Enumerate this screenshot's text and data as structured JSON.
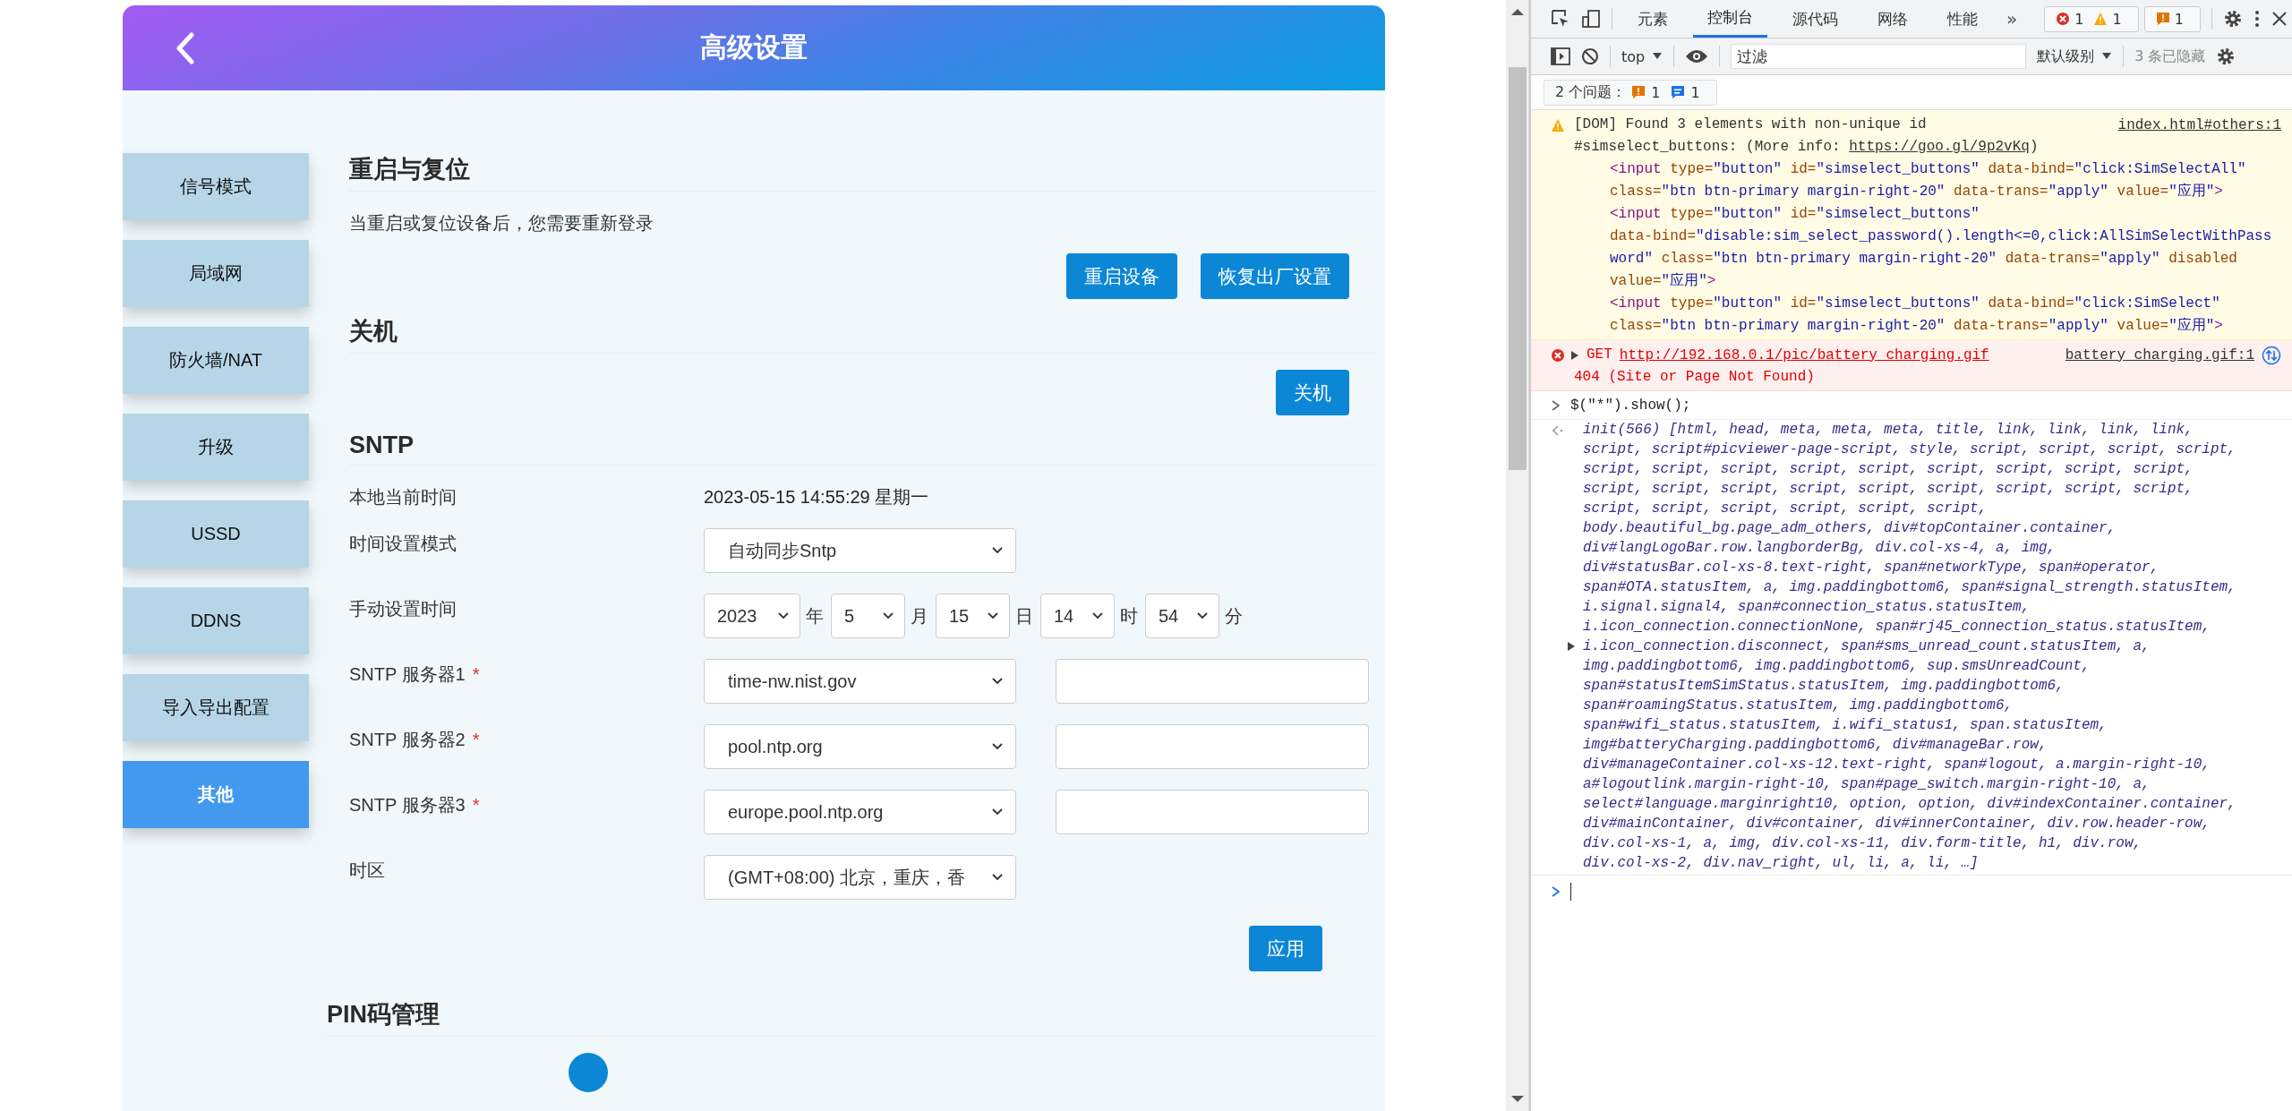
{
  "page": {
    "header": {
      "title": "高级设置"
    },
    "sidebar": {
      "items": [
        {
          "label": "信号模式",
          "selected": false
        },
        {
          "label": "局域网",
          "selected": false
        },
        {
          "label": "防火墙/NAT",
          "selected": false
        },
        {
          "label": "升级",
          "selected": false
        },
        {
          "label": "USSD",
          "selected": false
        },
        {
          "label": "DDNS",
          "selected": false
        },
        {
          "label": "导入导出配置",
          "selected": false
        },
        {
          "label": "其他",
          "selected": true
        }
      ]
    },
    "restart": {
      "title": "重启与复位",
      "note": "当重启或复位设备后，您需要重新登录",
      "buttons": [
        "重启设备",
        "恢复出厂设置"
      ]
    },
    "shutdown": {
      "title": "关机",
      "buttons": [
        "关机"
      ]
    },
    "sntp": {
      "title": "SNTP",
      "rows": [
        {
          "kind": "text",
          "label": "本地当前时间",
          "value": "2023-05-15 14:55:29 星期一"
        },
        {
          "kind": "select",
          "label": "时间设置模式",
          "value": "自动同步Sntp"
        },
        {
          "kind": "datetime",
          "label": "手动设置时间",
          "parts": [
            {
              "value": "2023",
              "unit": "年"
            },
            {
              "value": "5",
              "unit": "月"
            },
            {
              "value": "15",
              "unit": "日"
            },
            {
              "value": "14",
              "unit": "时"
            },
            {
              "value": "54",
              "unit": "分"
            }
          ]
        },
        {
          "kind": "server",
          "label": "SNTP 服务器1",
          "required": "*",
          "value": "time-nw.nist.gov"
        },
        {
          "kind": "server",
          "label": "SNTP 服务器2",
          "required": "*",
          "value": "pool.ntp.org"
        },
        {
          "kind": "server",
          "label": "SNTP 服务器3",
          "required": "*",
          "value": "europe.pool.ntp.org"
        },
        {
          "kind": "select",
          "label": "时区",
          "value": "(GMT+08:00) 北京，重庆，香"
        }
      ],
      "apply_button": "应用"
    },
    "pin": {
      "title": "PIN码管理"
    }
  },
  "devtools": {
    "tabs": [
      {
        "label": "元素",
        "selected": false
      },
      {
        "label": "控制台",
        "selected": true
      },
      {
        "label": "源代码",
        "selected": false
      },
      {
        "label": "网络",
        "selected": false
      },
      {
        "label": "性能",
        "selected": false
      }
    ],
    "more_tabs": "»",
    "counts": {
      "errors": "1",
      "warnings": "1",
      "issues": "1"
    },
    "toolbar": {
      "context": "top",
      "filter_placeholder": "过滤",
      "level": "默认级别",
      "hidden": "3 条已隐藏"
    },
    "issues_bar": {
      "label": "2 个问题：",
      "warnings": "1",
      "infos": "1"
    },
    "messages": [
      {
        "kind": "warning",
        "text": "[DOM] Found 3 elements with non-unique id",
        "source": "index.html#others:1",
        "detail": "#simselect_buttons: (More info: ",
        "link": "https://goo.gl/9p2vKq",
        "detail_end": ")",
        "code": [
          "<input type=\"button\" id=\"simselect_buttons\" data-bind=\"click:SimSelectAll\" class=\"btn btn-primary margin-right-20\" data-trans=\"apply\" value=\"应用\">",
          "<input type=\"button\" id=\"simselect_buttons\" data-bind=\"disable:sim_select_password().length<=0,click:AllSimSelectWithPassword\" class=\"btn btn-primary margin-right-20\" data-trans=\"apply\" disabled value=\"应用\">",
          "<input type=\"button\" id=\"simselect_buttons\" data-bind=\"click:SimSelect\" class=\"btn btn-primary margin-right-20\" data-trans=\"apply\" value=\"应用\">"
        ]
      },
      {
        "kind": "error",
        "method": "GET",
        "url": "http://192.168.0.1/pic/battery_charging.gif",
        "source": "battery_charging.gif:1",
        "detail": "404 (Site or Page Not Found)"
      },
      {
        "kind": "command",
        "text": "$(\"*\").show();"
      },
      {
        "kind": "result",
        "lines": [
          {
            "text": "init(566) [html, head, meta, meta, meta, title, link, link, link, link,",
            "expander": false
          },
          {
            "text": "script, script#picviewer-page-script, style, script, script, script, script,",
            "expander": false
          },
          {
            "text": "script, script, script, script, script, script, script, script, script,",
            "expander": false
          },
          {
            "text": "script, script, script, script, script, script, script, script, script,",
            "expander": false
          },
          {
            "text": "script, script, script, script, script, script,",
            "expander": false
          },
          {
            "text": "body.beautiful_bg.page_adm_others, div#topContainer.container,",
            "expander": false
          },
          {
            "text": "div#langLogoBar.row.langborderBg, div.col-xs-4, a, img,",
            "expander": false
          },
          {
            "text": "div#statusBar.col-xs-8.text-right, span#networkType, span#operator,",
            "expander": false
          },
          {
            "text": "span#OTA.statusItem, a, img.paddingbottom6, span#signal_strength.statusItem,",
            "expander": false
          },
          {
            "text": "i.signal.signal4, span#connection_status.statusItem,",
            "expander": false
          },
          {
            "text": "i.icon_connection.connectionNone, span#rj45_connection_status.statusItem,",
            "expander": false
          },
          {
            "text": "i.icon_connection.disconnect, span#sms_unread_count.statusItem, a,",
            "expander": true
          },
          {
            "text": "img.paddingbottom6, img.paddingbottom6, sup.smsUnreadCount,",
            "expander": false
          },
          {
            "text": "span#statusItemSimStatus.statusItem, img.paddingbottom6,",
            "expander": false
          },
          {
            "text": "span#roamingStatus.statusItem, img.paddingbottom6,",
            "expander": false
          },
          {
            "text": "span#wifi_status.statusItem, i.wifi_status1, span.statusItem,",
            "expander": false
          },
          {
            "text": "img#batteryCharging.paddingbottom6, div#manageBar.row,",
            "expander": false
          },
          {
            "text": "div#manageContainer.col-xs-12.text-right, span#logout, a.margin-right-10,",
            "expander": false
          },
          {
            "text": "a#logoutlink.margin-right-10, span#page_switch.margin-right-10, a,",
            "expander": false
          },
          {
            "text": "select#language.marginright10, option, option, div#indexContainer.container,",
            "expander": false
          },
          {
            "text": "div#mainContainer, div#container, div#innerContainer, div.row.header-row,",
            "expander": false
          },
          {
            "text": "div.col-xs-1, a, img, div.col-xs-11, div.form-title, h1, div.row,",
            "expander": false
          },
          {
            "text": "div.col-xs-2, div.nav_right, ul, li, a, li, …]",
            "expander": false
          }
        ]
      }
    ]
  }
}
